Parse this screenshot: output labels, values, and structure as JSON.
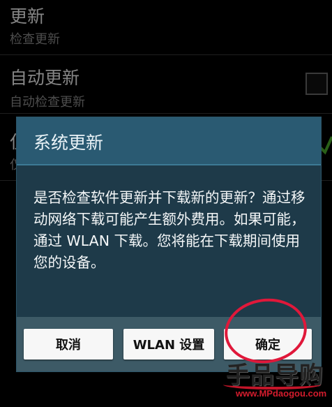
{
  "settings": {
    "update": {
      "title": "更新",
      "subtitle": "检查更新"
    },
    "auto_update": {
      "title": "自动更新",
      "subtitle": "自动检查更新"
    },
    "partial_row": {
      "title_char": "仅",
      "sub_char": "仅"
    }
  },
  "dialog": {
    "title": "系统更新",
    "message": "是否检查软件更新并下载新的更新？通过移动网络下载可能产生额外费用。如果可能，通过 WLAN 下载。您将能在下载期间使用您的设备。",
    "buttons": {
      "cancel": "取消",
      "wlan_settings": "WLAN 设置",
      "confirm": "确定"
    }
  },
  "watermark": {
    "logo": "手品导购",
    "url": "www.MPdaogou.com"
  },
  "colors": {
    "dialog_bg": "#1e3a49",
    "title_bg": "#2a5a72",
    "button_bar": "#3d5a66",
    "annotation": "#e0183a"
  }
}
